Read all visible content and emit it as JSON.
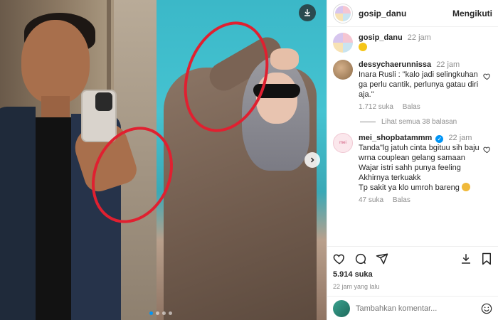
{
  "post": {
    "username": "gosip_danu",
    "follow_label": "Mengikuti",
    "carousel": {
      "slide_count": 4,
      "active_index": 0
    }
  },
  "caption": {
    "username": "gosip_danu",
    "time": "22 jam",
    "text_icon": "grinning-face-emoji"
  },
  "comments": [
    {
      "username": "dessychaerunnissa",
      "time": "22 jam",
      "text": "Inara Rusli : \"kalo jadi selingkuhan ga perlu cantik, perlunya gatau diri aja.\"",
      "likes": "1.712 suka",
      "reply_label": "Balas",
      "view_replies": "Lihat semua 38 balasan"
    },
    {
      "username": "mei_shopbatammm",
      "verified": true,
      "time": "22 jam",
      "lines": [
        "Tanda\"lg jatuh cinta bgituu sih baju",
        "wrna couplean gelang samaan",
        "Wajar istri sahh punya feeling",
        "Akhirnya terkuakk",
        "Tp sakit ya klo umroh bareng"
      ],
      "likes": "47 suka",
      "reply_label": "Balas"
    }
  ],
  "stats": {
    "likes": "5.914 suka",
    "posted": "22 jam yang lalu"
  },
  "add_comment": {
    "placeholder": "Tambahkan komentar..."
  },
  "icons": [
    "download-icon",
    "chevron-right-icon",
    "heart-icon",
    "comment-icon",
    "share-icon",
    "save-icon",
    "emoji-icon"
  ],
  "colors": {
    "accent": "#0095f6",
    "annotation_red": "#e02030",
    "muted": "#8e8e8e"
  }
}
